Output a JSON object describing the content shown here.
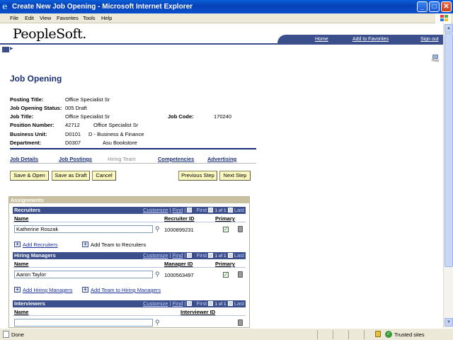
{
  "window": {
    "title": "Create New Job Opening - Microsoft Internet Explorer",
    "minimize": "_",
    "maximize": "□",
    "close": "✕"
  },
  "menu": [
    "File",
    "Edit",
    "View",
    "Favorites",
    "Tools",
    "Help"
  ],
  "header": {
    "logo": "PeopleSoft.",
    "links": {
      "home": "Home",
      "favorites": "Add to Favorites",
      "signout": "Sign out"
    },
    "help_label": "Help"
  },
  "page_title": "Job Opening",
  "fields": {
    "posting_title_label": "Posting Title:",
    "posting_title": "Office Specialist Sr",
    "status_label": "Job Opening Status:",
    "status": "005 Draft",
    "job_title_label": "Job Title:",
    "job_title": "Office Specialist Sr",
    "job_code_label": "Job Code:",
    "job_code": "170240",
    "position_label": "Position Number:",
    "position_number": "42712",
    "position_desc": "Office Specialist Sr",
    "bu_label": "Business Unit:",
    "bu_code": "D0101",
    "bu_desc": "D - Business & Finance",
    "dept_label": "Department:",
    "dept_code": "D0307",
    "dept_desc": "Asu Bookstore"
  },
  "tabs": {
    "details": "Job Details",
    "postings": "Job Postings",
    "hiring_team": "Hiring Team",
    "competencies": "Competencies",
    "advertising": "Advertising"
  },
  "buttons": {
    "save_open": "Save & Open",
    "save_draft": "Save as Draft",
    "cancel": "Cancel",
    "prev": "Previous Step",
    "next": "Next Step"
  },
  "assignments": {
    "title": "Assignments",
    "customize": "Customize",
    "find": "Find",
    "first": "First",
    "last": "Last",
    "count": "1 of 1",
    "recruiters": {
      "title": "Recruiters",
      "col_name": "Name",
      "col_id": "Recruiter ID",
      "col_primary": "Primary",
      "name": "Katherine Roszak",
      "id": "1000899231",
      "add_link": "Add Recruiters",
      "add_team": "Add Team to Recruiters"
    },
    "managers": {
      "title": "Hiring Managers",
      "col_name": "Name",
      "col_id": "Manager ID",
      "col_primary": "Primary",
      "name": "Aaron Taylor",
      "id": "1000563497",
      "add_link": "Add Hiring Managers",
      "add_team": "Add Team to Hiring Managers"
    },
    "interviewers": {
      "title": "Interviewers",
      "col_name": "Name",
      "col_id": "Interviewer ID",
      "name": ""
    }
  },
  "status": {
    "done": "Done",
    "zone": "Trusted sites"
  },
  "colors": {
    "brand_blue": "#3a4f8c",
    "title_blue": "#1a2f75",
    "button_yellow": "#fbf8c0"
  }
}
